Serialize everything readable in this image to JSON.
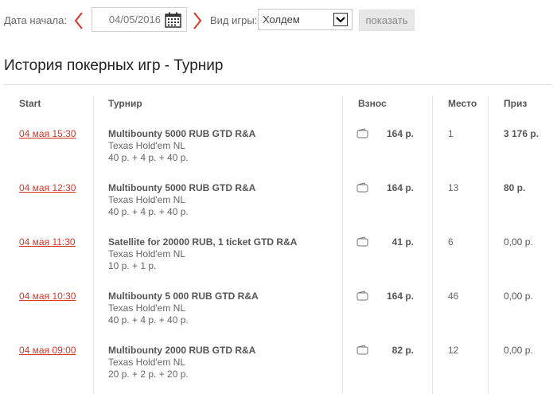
{
  "filter": {
    "start_date_label": "Дата начала:",
    "start_date_value": "04/05/2016",
    "game_type_label": "Вид игры:",
    "game_type_value": "Холдем",
    "show_button": "показать"
  },
  "page_title": "История покерных игр - Турнир",
  "table": {
    "headers": {
      "start": "Start",
      "tournament": "Турнир",
      "buyin": "Взнос",
      "place": "Место",
      "prize": "Приз"
    },
    "rows": [
      {
        "start": "04 мая 15:30",
        "name": "Multibounty 5000 RUB GTD R&A",
        "type": "Texas Hold'em NL",
        "fee": "40 р. + 4 р. + 40 р.",
        "buyin": "164 р.",
        "place": "1",
        "prize": "3 176 р.",
        "prize_bold": true
      },
      {
        "start": "04 мая 12:30",
        "name": "Multibounty 5000 RUB GTD R&A",
        "type": "Texas Hold'em NL",
        "fee": "40 р. + 4 р. + 40 р.",
        "buyin": "164 р.",
        "place": "13",
        "prize": "80 р.",
        "prize_bold": true
      },
      {
        "start": "04 мая 11:30",
        "name": "Satellite for 20000 RUB, 1 ticket GTD R&A",
        "type": "Texas Hold'em NL",
        "fee": "10 р. + 1 р.",
        "buyin": "41 р.",
        "place": "6",
        "prize": "0,00 р.",
        "prize_bold": false
      },
      {
        "start": "04 мая 10:30",
        "name": "Multibounty 5 000 RUB GTD R&A",
        "type": "Texas Hold'em NL",
        "fee": "40 р. + 4 р. + 40 р.",
        "buyin": "164 р.",
        "place": "46",
        "prize": "0,00 р.",
        "prize_bold": false
      },
      {
        "start": "04 мая 09:00",
        "name": "Multibounty 2000 RUB GTD R&A",
        "type": "Texas Hold'em NL",
        "fee": "20 р. + 2 р. + 20 р.",
        "buyin": "82 р.",
        "place": "12",
        "prize": "0,00 р.",
        "prize_bold": false
      }
    ]
  },
  "colors": {
    "link": "#d9362b",
    "arrow": "#d9362b",
    "divider": "#e6e6e6"
  },
  "icons": {
    "prev": "chevron-left-icon",
    "next": "chevron-right-icon",
    "calendar": "calendar-icon",
    "dropdown": "chevron-down-icon",
    "wallet": "wallet-icon"
  }
}
